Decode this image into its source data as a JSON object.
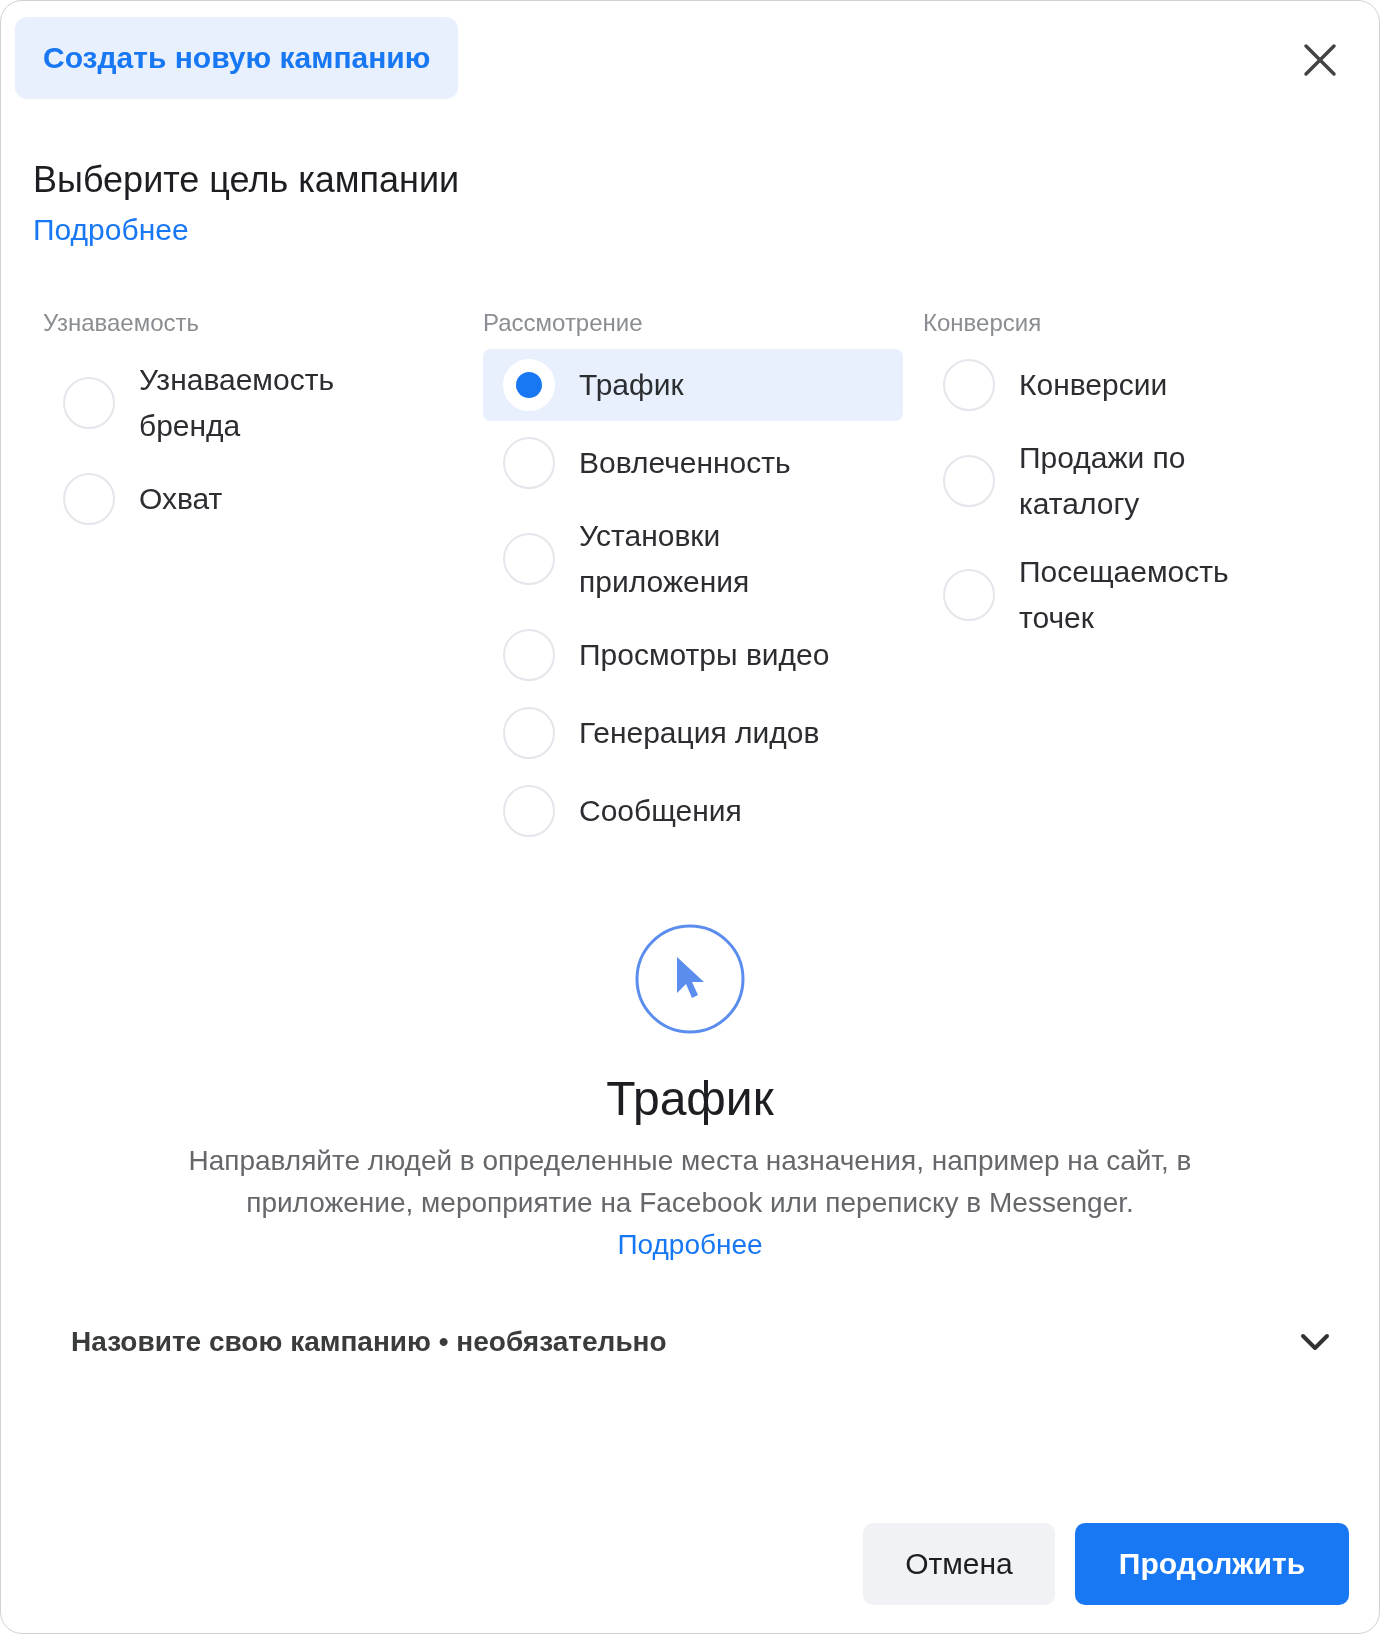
{
  "header_tab": {
    "label": "Создать новую кампанию",
    "selected": true
  },
  "title": "Выберите цель кампании",
  "learn_more": "Подробнее",
  "columns": [
    {
      "heading": "Узнаваемость",
      "options": [
        {
          "label": "Узнаваемость бренда",
          "selected": false
        },
        {
          "label": "Охват",
          "selected": false
        }
      ]
    },
    {
      "heading": "Рассмотрение",
      "options": [
        {
          "label": "Трафик",
          "selected": true
        },
        {
          "label": "Вовлеченность",
          "selected": false
        },
        {
          "label": "Установки приложения",
          "selected": false
        },
        {
          "label": "Просмотры видео",
          "selected": false
        },
        {
          "label": "Генерация лидов",
          "selected": false
        },
        {
          "label": "Сообщения",
          "selected": false
        }
      ]
    },
    {
      "heading": "Конверсия",
      "options": [
        {
          "label": "Конверсии",
          "selected": false
        },
        {
          "label": "Продажи по каталогу",
          "selected": false
        },
        {
          "label": "Посещаемость точек",
          "selected": false
        }
      ]
    }
  ],
  "detail": {
    "title": "Трафик",
    "description": "Направляйте людей в определенные места назначения, например на сайт, в приложение, мероприятие на Facebook или переписку в Messenger.",
    "link": "Подробнее"
  },
  "name_section": {
    "label": "Назовите свою кампанию • необязательно",
    "expanded": false
  },
  "buttons": [
    {
      "label": "Отмена",
      "kind": "secondary"
    },
    {
      "label": "Продолжить",
      "kind": "primary"
    }
  ]
}
